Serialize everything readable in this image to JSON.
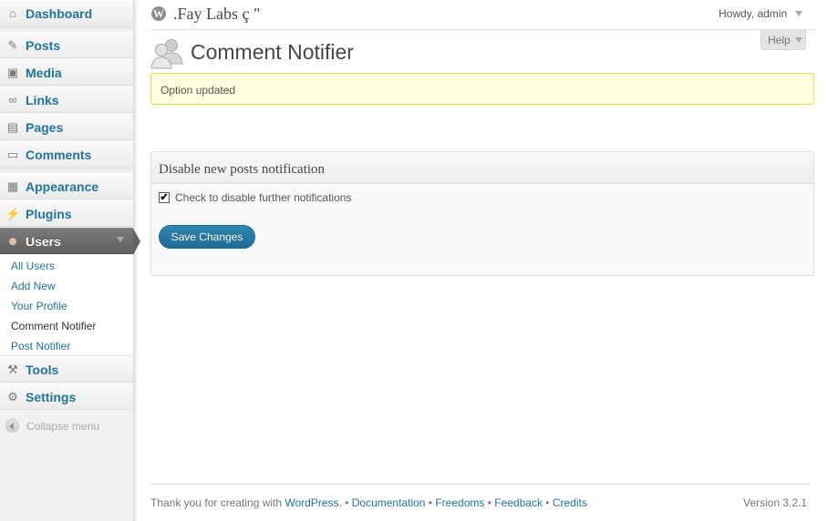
{
  "site": {
    "title": ".Fay Labs ç \"",
    "logo_letter": "W"
  },
  "user": {
    "greeting": "Howdy, admin"
  },
  "help": {
    "label": "Help"
  },
  "page": {
    "title": "Comment Notifier"
  },
  "notice": {
    "text": "Option updated"
  },
  "menu": {
    "dashboard": "Dashboard",
    "posts": "Posts",
    "media": "Media",
    "links": "Links",
    "pages": "Pages",
    "comments": "Comments",
    "appearance": "Appearance",
    "plugins": "Plugins",
    "users": "Users",
    "tools": "Tools",
    "settings": "Settings",
    "collapse": "Collapse menu"
  },
  "users_submenu": [
    "All Users",
    "Add New",
    "Your Profile",
    "Comment Notifier",
    "Post Notifier"
  ],
  "postbox": {
    "title": "Disable new posts notification",
    "checkbox_label": "Check to disable further notifications",
    "checkbox_checked": true,
    "checkbox_mark": "✔",
    "save_label": "Save Changes"
  },
  "footer": {
    "thanks": "Thank you for creating with ",
    "wordpress": "WordPress",
    "sep1": ". • ",
    "documentation": "Documentation",
    "sep2": " • ",
    "freedoms": "Freedoms",
    "sep3": " • ",
    "feedback": "Feedback",
    "sep4": " • ",
    "credits": "Credits",
    "version": "Version 3.2.1"
  },
  "colors": {
    "link": "#21759b",
    "notice_bg": "#ffffe0",
    "notice_border": "#e6db55",
    "button": "#21759b"
  }
}
